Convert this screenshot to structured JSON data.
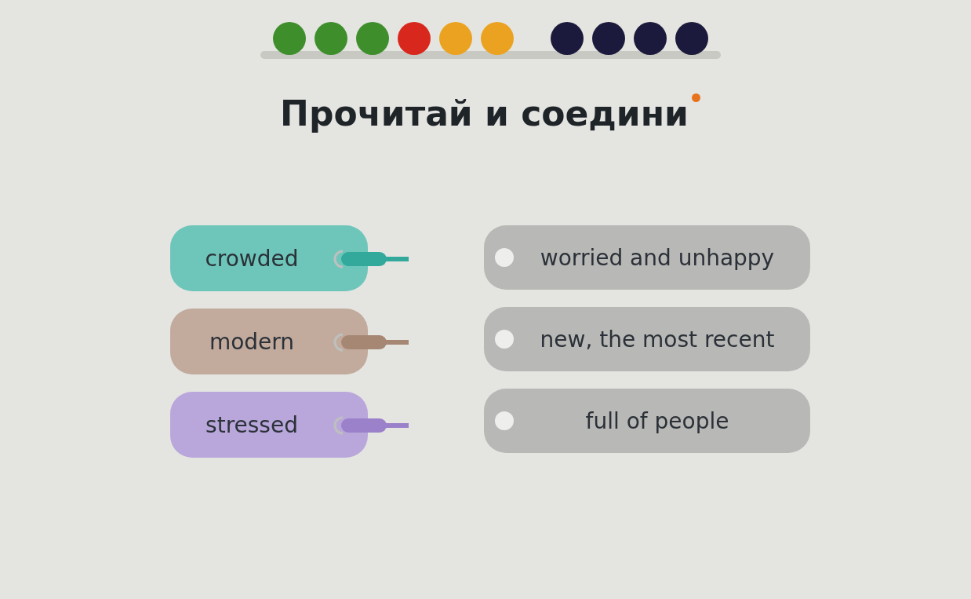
{
  "progress": {
    "groups": [
      {
        "dots": [
          {
            "color": "#3e8e2c"
          },
          {
            "color": "#3e8e2c"
          },
          {
            "color": "#3e8e2c"
          },
          {
            "color": "#d8281e"
          },
          {
            "color": "#eba220"
          },
          {
            "color": "#eba220"
          }
        ]
      },
      {
        "dots": [
          {
            "color": "#1c1a3c"
          },
          {
            "color": "#1c1a3c"
          },
          {
            "color": "#1c1a3c"
          },
          {
            "color": "#1c1a3c"
          }
        ]
      }
    ]
  },
  "title": "Прочитай и соедини",
  "words": [
    {
      "label": "crowded",
      "color": "#6ec6bb"
    },
    {
      "label": "modern",
      "color": "#c2ab9d"
    },
    {
      "label": "stressed",
      "color": "#b9a7dc"
    }
  ],
  "definitions": [
    {
      "label": "worried and unhappy"
    },
    {
      "label": "new, the most recent"
    },
    {
      "label": "full of people"
    }
  ]
}
